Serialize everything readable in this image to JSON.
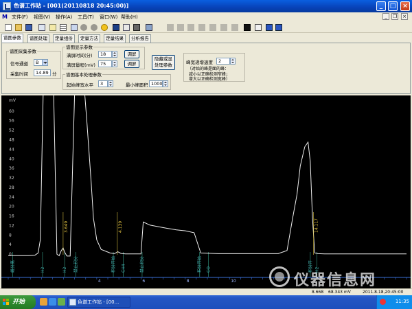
{
  "window": {
    "title": "色谱工作站 - [001(20110818 20:45:00)]",
    "minimize": "_",
    "maximize": "□",
    "close": "×",
    "mdi_min": "_",
    "mdi_restore": "❐",
    "mdi_close": "×"
  },
  "menu": [
    "文件(F)",
    "视图(V)",
    "操作(A)",
    "工具(T)",
    "窗口(W)",
    "帮助(H)"
  ],
  "tabs": [
    "谱图参数",
    "谱图处理",
    "定量组份",
    "定量方法",
    "定量结果",
    "分析报告"
  ],
  "params": {
    "acquire_group": "谱图采集参数",
    "channel_label": "信号通道",
    "channel_value": "B",
    "acq_time_label": "采集时间",
    "acq_time_value": "14.89",
    "acq_time_unit": "分",
    "display_group": "谱图显示参数",
    "full_time_label": "满屏时间(分)",
    "full_time_value": "18",
    "full_range_label": "满屏量程(mV)",
    "full_range_value": "75",
    "adjust_button": "调屏",
    "adjust_button2": "调屏",
    "hide_button": "隐藏或显\n处理参数",
    "proc_group": "谱图基本处理参数",
    "threshold_label": "起始峰宽水平",
    "threshold_value": "3",
    "min_area_label": "最小峰面积",
    "min_area_value": "1000",
    "peak_width_label": "峰宽递增速度",
    "peak_width_value": "2",
    "hint": "（对始的峰是面的峰：\n 减小以正确检测窄峰；\n 增大以正确检测宽峰）"
  },
  "status": {
    "value1": "8.668",
    "value2": "68.343 mV",
    "datetime": "2011.8.18,20:45:00"
  },
  "taskbar": {
    "start": "开始",
    "task_button": "色谱工作站 - [00...",
    "clock": "11:35"
  },
  "watermark": "仪器信息网",
  "chart_data": {
    "type": "line",
    "ylabel": "mV",
    "xlim": [
      0,
      18
    ],
    "ylim": [
      -4,
      66
    ],
    "yticks": [
      60,
      56,
      52,
      48,
      44,
      40,
      36,
      32,
      28,
      24,
      20,
      16,
      12,
      8,
      4,
      0
    ],
    "xtick_labels": [
      "4",
      "6",
      "8",
      "10"
    ],
    "xticks": [
      4,
      6,
      8,
      10
    ],
    "peak_labels": [
      {
        "x": 2.48,
        "text": "3.649"
      },
      {
        "x": 4.93,
        "text": "4.139"
      },
      {
        "x": 13.8,
        "text": "14.117"
      }
    ],
    "events": [
      {
        "x": 0.2,
        "text": "峰分离"
      },
      {
        "x": 1.55,
        "text": "H2"
      },
      {
        "x": 2.55,
        "text": "H2"
      },
      {
        "x": 3.05,
        "text": "禁止积分"
      },
      {
        "x": 4.75,
        "text": "积分开始"
      },
      {
        "x": 5.2,
        "text": "CH4"
      },
      {
        "x": 6.05,
        "text": "禁止积分"
      },
      {
        "x": 8.65,
        "text": "积分开始"
      },
      {
        "x": 9.05,
        "text": "CO"
      },
      {
        "x": 13.65,
        "text": "积分开"
      },
      {
        "x": 13.95,
        "text": "H2"
      }
    ],
    "series": [
      {
        "color": "#f0f0f0",
        "x": [
          0.0,
          0.9,
          1.2,
          1.35,
          1.45,
          1.52,
          1.58,
          1.65,
          1.8,
          1.95,
          2.05,
          2.2,
          2.3,
          2.4,
          2.48,
          2.55,
          2.65,
          2.8,
          3.0,
          3.1,
          3.3,
          3.45,
          3.55,
          3.65,
          3.75,
          3.85,
          4.0,
          4.2,
          4.6,
          4.8,
          4.95,
          5.1,
          5.3,
          5.6,
          5.8,
          6.0,
          6.1,
          6.4,
          6.8,
          7.2,
          7.6,
          8.0,
          8.4,
          8.7,
          9.5,
          10.5,
          11.5,
          12.2,
          12.6,
          12.85,
          13.05,
          13.2,
          13.4,
          13.55,
          13.65,
          13.75,
          13.85,
          14.0,
          14.3,
          15.0,
          16.0,
          17.0,
          18.0
        ],
        "y": [
          -0.6,
          -0.6,
          -0.5,
          0.5,
          6,
          40,
          70,
          70,
          70,
          70,
          70,
          0,
          -0.7,
          1.5,
          2.6,
          0.8,
          -0.8,
          -0.8,
          70,
          70,
          70,
          70,
          56,
          43,
          30,
          15,
          6,
          2,
          0.5,
          0.2,
          1.0,
          0.3,
          0.1,
          0.1,
          0.1,
          0.1,
          13.5,
          12.2,
          11.5,
          10.8,
          10.2,
          9.8,
          9.0,
          0.5,
          0.2,
          0.2,
          0.2,
          0.2,
          1.5,
          15,
          25,
          37,
          45,
          47,
          39,
          15,
          0.5,
          0.2,
          0.1,
          0.1,
          0.1,
          0.1,
          0.1
        ]
      }
    ]
  }
}
